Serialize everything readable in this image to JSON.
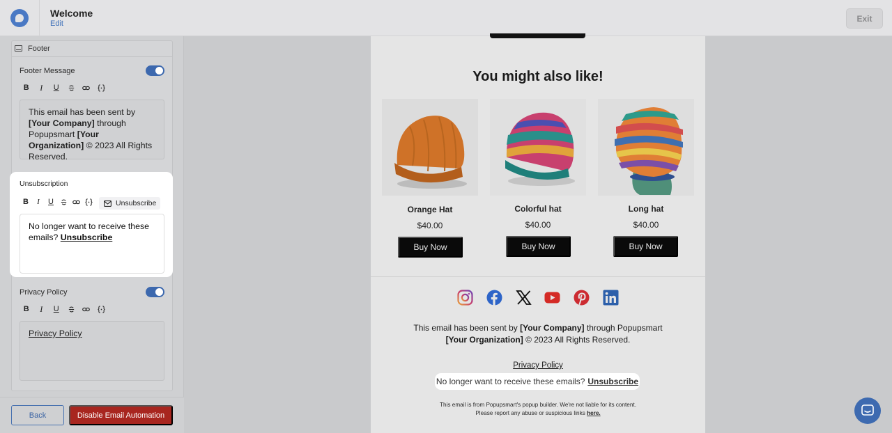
{
  "header": {
    "title": "Welcome",
    "edit_label": "Edit",
    "exit_label": "Exit",
    "logo_icon": "popupsmart-logo-icon"
  },
  "sidebar": {
    "section_title": "Footer",
    "section_icon": "footer-layout-icon",
    "footer_message": {
      "label": "Footer Message",
      "enabled": true,
      "text_1": "This email has been sent by ",
      "company": "[Your Company]",
      "text_2": " through Popupsmart ",
      "organization": "[Your Organization]",
      "text_3": " © 2023 All Rights Reserved."
    },
    "unsubscription": {
      "label": "Unsubscription",
      "insert_button_label": "Unsubscribe",
      "insert_icon": "mail-icon",
      "text": "No longer want to receive these emails? ",
      "link_text": " Unsubscribe "
    },
    "privacy_policy": {
      "label": "Privacy Policy",
      "enabled": true,
      "link_text": "Privacy Policy"
    },
    "toolbar_tools": [
      "B",
      "I",
      "U",
      "strikethrough-icon",
      "link-icon",
      "variable-braces-icon"
    ],
    "back_label": "Back",
    "disable_label": "Disable Email Automation"
  },
  "email": {
    "heading": "You might also like!",
    "products": [
      {
        "name": "Orange Hat",
        "price": "$40.00",
        "button": "Buy Now",
        "image_color": "#d77a2c"
      },
      {
        "name": "Colorful hat",
        "price": "$40.00",
        "button": "Buy Now",
        "image_color": "#c8406e"
      },
      {
        "name": "Long hat",
        "price": "$40.00",
        "button": "Buy Now",
        "image_color": "#e07e35"
      }
    ],
    "socials": [
      "instagram-icon",
      "facebook-icon",
      "x-icon",
      "youtube-icon",
      "pinterest-icon",
      "linkedin-icon"
    ],
    "footer": {
      "line1_pre": "This email has been sent by ",
      "company": "[Your Company]",
      "line1_post": " through Popupsmart",
      "organization": "[Your Organization]",
      "line2_post": " © 2023 All Rights Reserved."
    },
    "privacy_link": "Privacy Policy",
    "unsubscribe_text": "No longer want to receive these emails?",
    "unsubscribe_link": "Unsubscribe",
    "disclaimer_line1": "This email is from Popupsmart's popup builder. We're not liable for its content.",
    "disclaimer_line2": "Please report any abuse or suspicious links ",
    "disclaimer_link": "here."
  },
  "colors": {
    "accent": "#3c68ae",
    "danger": "#a8261f"
  }
}
